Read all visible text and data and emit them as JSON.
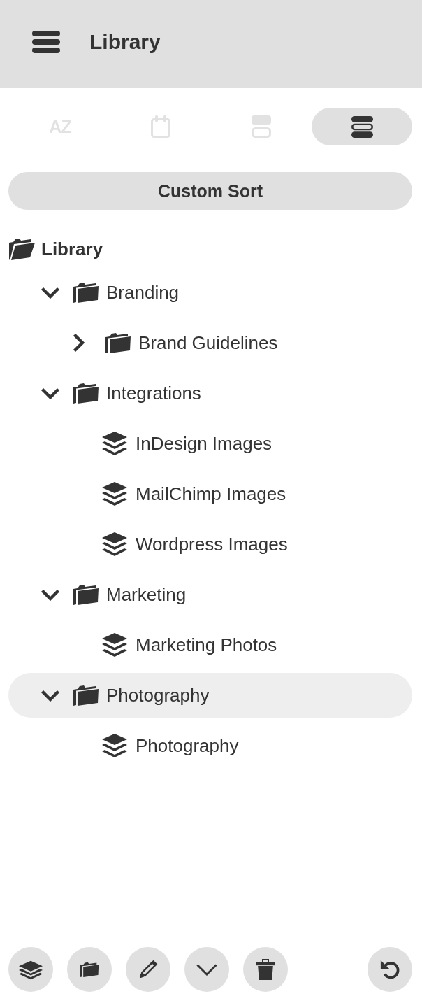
{
  "header": {
    "title": "Library"
  },
  "sort_tabs": [
    {
      "kind": "alphabetical",
      "label": "AZ",
      "selected": false
    },
    {
      "kind": "date",
      "selected": false
    },
    {
      "kind": "compact",
      "selected": false
    },
    {
      "kind": "custom",
      "selected": true
    }
  ],
  "sort_button": {
    "label": "Custom Sort"
  },
  "tree": {
    "label": "Library",
    "children": [
      {
        "kind": "folder",
        "label": "Branding",
        "expanded": true,
        "selected": false,
        "children": [
          {
            "kind": "folder",
            "label": "Brand Guidelines",
            "expanded": false,
            "selected": false
          }
        ]
      },
      {
        "kind": "folder",
        "label": "Integrations",
        "expanded": true,
        "selected": false,
        "children": [
          {
            "kind": "collection",
            "label": "InDesign Images",
            "selected": false
          },
          {
            "kind": "collection",
            "label": "MailChimp Images",
            "selected": false
          },
          {
            "kind": "collection",
            "label": "Wordpress Images",
            "selected": false
          }
        ]
      },
      {
        "kind": "folder",
        "label": "Marketing",
        "expanded": true,
        "selected": false,
        "children": [
          {
            "kind": "collection",
            "label": "Marketing Photos",
            "selected": false
          }
        ]
      },
      {
        "kind": "folder",
        "label": "Photography",
        "expanded": true,
        "selected": true,
        "children": [
          {
            "kind": "collection",
            "label": "Photography",
            "selected": false
          }
        ]
      }
    ]
  }
}
